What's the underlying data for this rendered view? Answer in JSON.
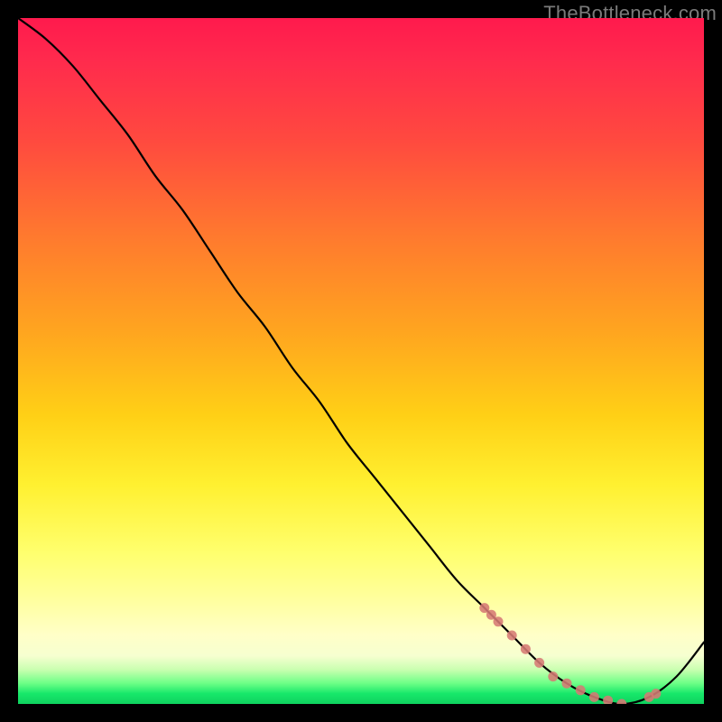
{
  "watermark": "TheBottleneck.com",
  "colors": {
    "black": "#000000",
    "curve": "#000000",
    "marker": "#d67a74",
    "gradient_top": "#ff1a4d",
    "gradient_mid": "#ffd016",
    "gradient_bottom": "#0fd15e"
  },
  "chart_data": {
    "type": "line",
    "title": "",
    "xlabel": "",
    "ylabel": "",
    "xlim": [
      0,
      100
    ],
    "ylim": [
      0,
      100
    ],
    "grid": false,
    "legend": false,
    "series": [
      {
        "name": "curve",
        "x": [
          0,
          4,
          8,
          12,
          16,
          20,
          24,
          28,
          32,
          36,
          40,
          44,
          48,
          52,
          56,
          60,
          64,
          68,
          72,
          76,
          80,
          84,
          88,
          92,
          96,
          100
        ],
        "y": [
          100,
          97,
          93,
          88,
          83,
          77,
          72,
          66,
          60,
          55,
          49,
          44,
          38,
          33,
          28,
          23,
          18,
          14,
          10,
          6,
          3,
          1,
          0,
          1,
          4,
          9
        ]
      }
    ],
    "markers": {
      "name": "highlighted-points",
      "x": [
        68,
        69,
        70,
        72,
        74,
        76,
        78,
        80,
        82,
        84,
        86,
        88,
        92,
        93
      ],
      "y": [
        14,
        13,
        12,
        10,
        8,
        6,
        4,
        3,
        2,
        1,
        0.5,
        0,
        1,
        1.5
      ]
    }
  }
}
